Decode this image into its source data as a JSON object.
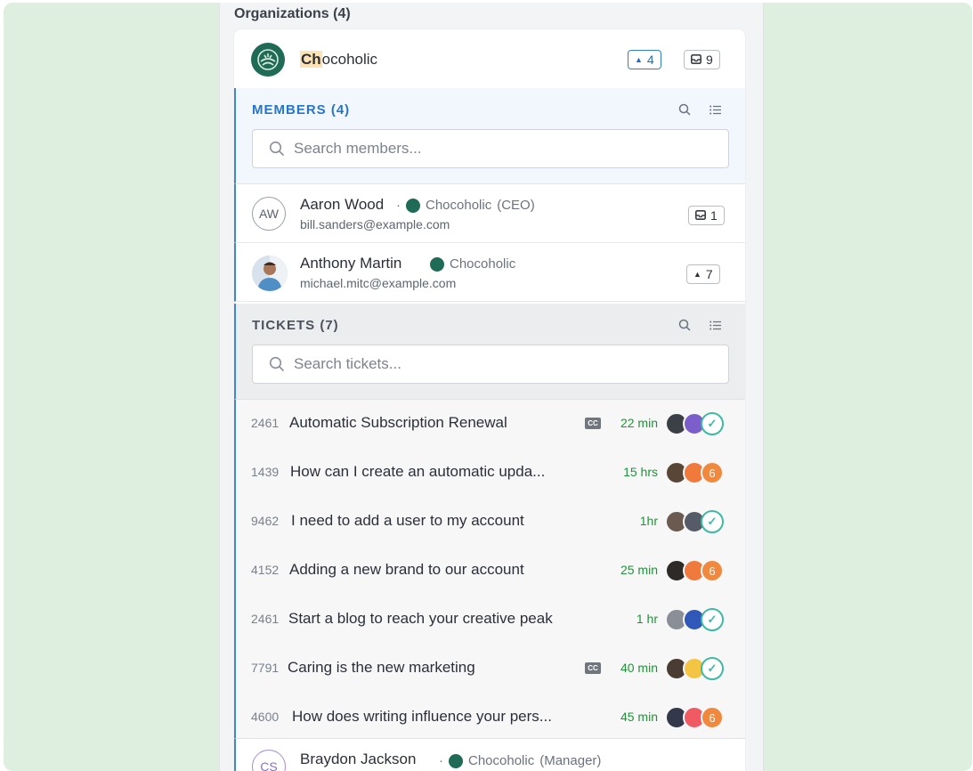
{
  "org_section": {
    "title": "Organizations (4)"
  },
  "org": {
    "name_highlight": "Ch",
    "name_rest": "ocoholic",
    "tickets_count": "4",
    "inbox_count": "9"
  },
  "members": {
    "title": "MEMBERS (4)",
    "search_placeholder": "Search members...",
    "items": [
      {
        "initials": "AW",
        "name": "Aaron Wood",
        "separator": "·",
        "org": "Chocoholic",
        "role": "(CEO)",
        "email": "bill.sanders@example.com",
        "badge_icon": "inbox-icon",
        "badge_count": "1"
      },
      {
        "name": "Anthony Martin",
        "org": "Chocoholic",
        "email": "michael.mitc@example.com",
        "badge_icon": "caret-up-icon",
        "badge_count": "7"
      }
    ]
  },
  "tickets": {
    "title": "TICKETS (7)",
    "search_placeholder": "Search tickets...",
    "cc_label": "CC",
    "items": [
      {
        "id": "2461",
        "title": "Automatic Subscription Renewal",
        "cc": true,
        "time": "22 min",
        "end": "check",
        "colors": [
          "#3b3f46",
          "#7b5ec9"
        ]
      },
      {
        "id": "1439",
        "title": "How can I create an automatic upda...",
        "cc": false,
        "time": "15 hrs",
        "end": "6",
        "colors": [
          "#5a4637",
          "#f07a3c"
        ]
      },
      {
        "id": "9462",
        "title": "I need to add a user to my account",
        "cc": false,
        "time": "1hr",
        "end": "check",
        "colors": [
          "#6a5a4f",
          "#555c68"
        ]
      },
      {
        "id": "4152",
        "title": "Adding a new brand to our account",
        "cc": false,
        "time": "25 min",
        "end": "6",
        "colors": [
          "#2d2a28",
          "#f07a3c"
        ]
      },
      {
        "id": "2461",
        "title": "Start a blog to reach your creative peak",
        "cc": false,
        "time": "1 hr",
        "end": "check",
        "colors": [
          "#8a8e96",
          "#2f58b8"
        ]
      },
      {
        "id": "7791",
        "title": "Caring is the new marketing",
        "cc": true,
        "time": "40 min",
        "end": "check",
        "colors": [
          "#4a3b33",
          "#f4c542"
        ]
      },
      {
        "id": "4600",
        "title": "How does writing influence your pers...",
        "cc": false,
        "time": "45 min",
        "end": "6",
        "colors": [
          "#33394a",
          "#f05b63"
        ]
      }
    ]
  },
  "bottom_member": {
    "initials": "CS",
    "name": "Braydon Jackson",
    "separator": "·",
    "org": "Chocoholic",
    "role": "(Manager)"
  }
}
